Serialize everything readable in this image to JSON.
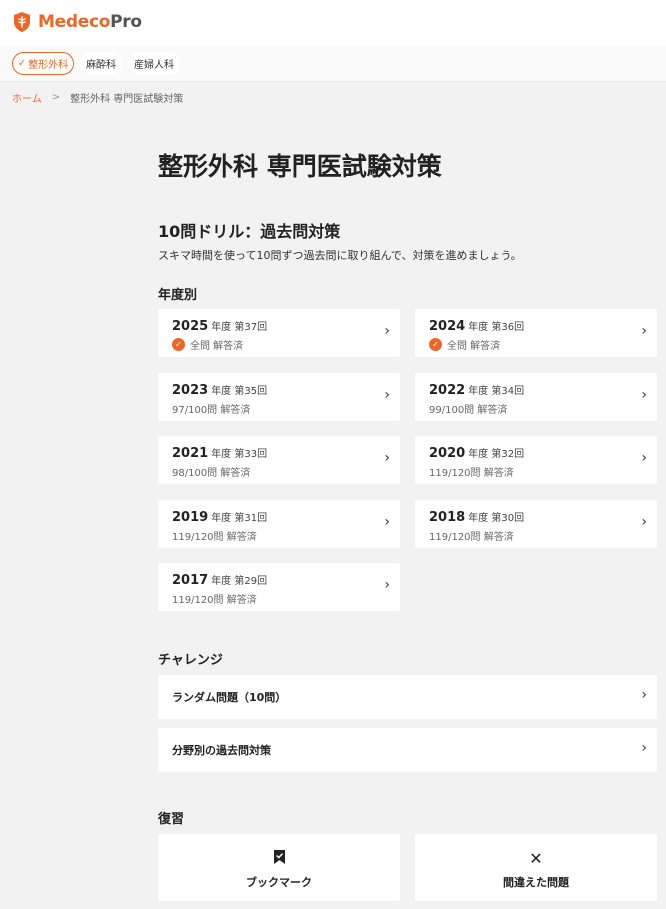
{
  "brand": {
    "name_main": "Medeco",
    "name_suffix": "Pro",
    "accent_color": "#e8672a"
  },
  "tabs": [
    {
      "label": "整形外科",
      "active": true
    },
    {
      "label": "麻酔科",
      "active": false
    },
    {
      "label": "産婦人科",
      "active": false
    }
  ],
  "breadcrumb": {
    "home": "ホーム",
    "separator": ">",
    "current": "整形外科 専門医試験対策"
  },
  "page": {
    "title": "整形外科 専門医試験対策"
  },
  "drill": {
    "title": "10問ドリル：過去問対策",
    "description": "スキマ時間を使って10問ずつ過去問に取り組んで、対策を進めましょう。"
  },
  "by_year": {
    "heading": "年度別",
    "items": [
      {
        "year": "2025",
        "suffix": "年度 第37回",
        "status": "全問 解答済",
        "complete": true
      },
      {
        "year": "2024",
        "suffix": "年度 第36回",
        "status": "全問 解答済",
        "complete": true
      },
      {
        "year": "2023",
        "suffix": "年度 第35回",
        "status": "97/100問 解答済",
        "complete": false
      },
      {
        "year": "2022",
        "suffix": "年度 第34回",
        "status": "99/100問 解答済",
        "complete": false
      },
      {
        "year": "2021",
        "suffix": "年度 第33回",
        "status": "98/100問 解答済",
        "complete": false
      },
      {
        "year": "2020",
        "suffix": "年度 第32回",
        "status": "119/120問 解答済",
        "complete": false
      },
      {
        "year": "2019",
        "suffix": "年度 第31回",
        "status": "119/120問 解答済",
        "complete": false
      },
      {
        "year": "2018",
        "suffix": "年度 第30回",
        "status": "119/120問 解答済",
        "complete": false
      },
      {
        "year": "2017",
        "suffix": "年度 第29回",
        "status": "119/120問 解答済",
        "complete": false
      }
    ]
  },
  "challenge": {
    "heading": "チャレンジ",
    "items": [
      {
        "label": "ランダム問題（10問）"
      },
      {
        "label": "分野別の過去問対策"
      }
    ]
  },
  "review": {
    "heading": "復習",
    "items": [
      {
        "label": "ブックマーク",
        "icon": "bookmark-icon"
      },
      {
        "label": "間違えた問題",
        "icon": "x-mark-icon"
      }
    ]
  }
}
